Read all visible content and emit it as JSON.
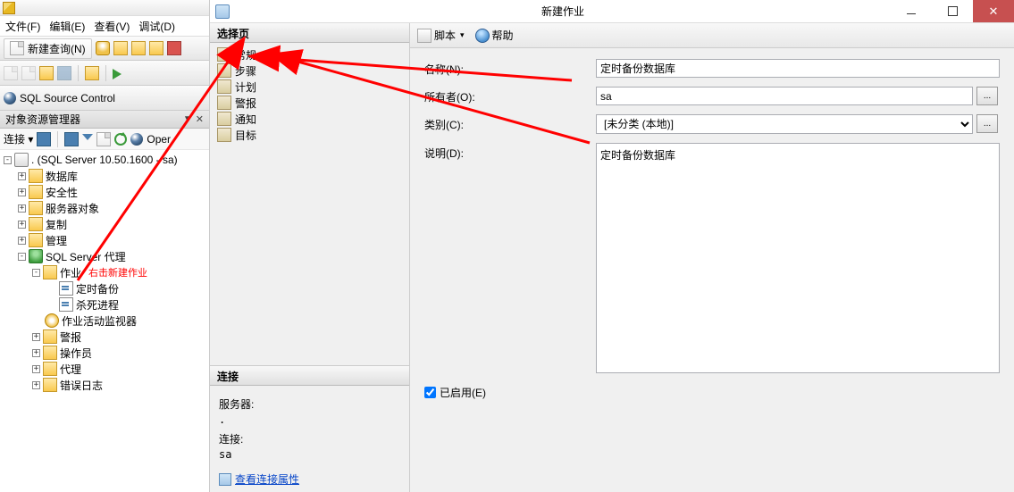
{
  "menu": {
    "file": "文件(F)",
    "edit": "编辑(E)",
    "view": "查看(V)",
    "debug": "调试(D)"
  },
  "toolbar": {
    "new_query": "新建查询(N)"
  },
  "sql_source": "SQL Source Control",
  "object_explorer": {
    "title": "对象资源管理器",
    "connect": "连接 ▾",
    "open_label": "Oper"
  },
  "tree": {
    "root": ". (SQL Server 10.50.1600 - sa)",
    "databases": "数据库",
    "security": "安全性",
    "server_objects": "服务器对象",
    "replication": "复制",
    "management": "管理",
    "agent": "SQL Server 代理",
    "jobs": "作业",
    "job_hint": "右击新建作业",
    "job1": "定时备份",
    "job2": "杀死进程",
    "activity_monitor": "作业活动监视器",
    "alerts": "警报",
    "operators": "操作员",
    "proxies": "代理",
    "error_logs": "错误日志"
  },
  "dialog": {
    "title": "新建作业",
    "select_page": "选择页",
    "pages": {
      "general": "常规",
      "steps": "步骤",
      "schedules": "计划",
      "alerts": "警报",
      "notifications": "通知",
      "targets": "目标"
    },
    "connection": "连接",
    "server_label": "服务器:",
    "server_value": ".",
    "conn_label": "连接:",
    "conn_value": "sa",
    "view_conn_props": "查看连接属性",
    "toolbar": {
      "script": "脚本",
      "help": "帮助"
    },
    "form": {
      "name_label": "名称(N):",
      "name_value": "定时备份数据库",
      "owner_label": "所有者(O):",
      "owner_value": "sa",
      "category_label": "类别(C):",
      "category_value": "[未分类 (本地)]",
      "desc_label": "说明(D):",
      "desc_value": "定时备份数据库",
      "enabled_label": "已启用(E)"
    }
  }
}
